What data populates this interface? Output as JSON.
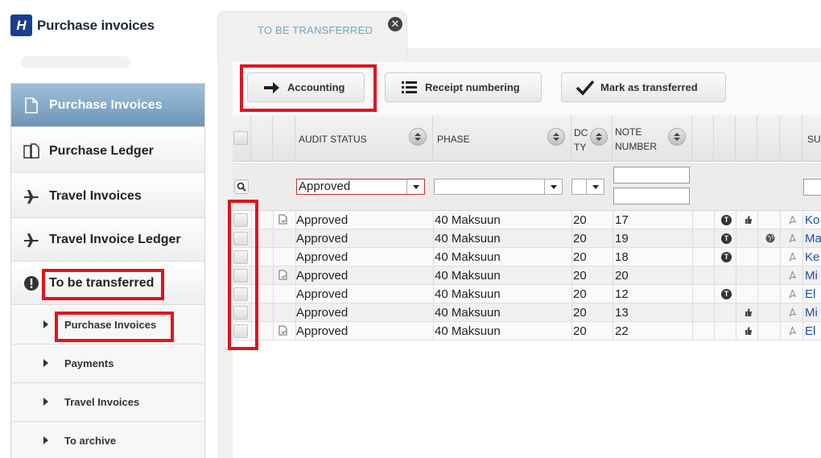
{
  "app": {
    "title": "Purchase invoices",
    "logo_letter": "H"
  },
  "sidebar": {
    "items": [
      {
        "label": "Purchase Invoices",
        "icon": "document-icon",
        "active": true
      },
      {
        "label": "Purchase Ledger",
        "icon": "documents-icon"
      },
      {
        "label": "Travel Invoices",
        "icon": "airplane-icon"
      },
      {
        "label": "Travel Invoice Ledger",
        "icon": "airplane-icon"
      },
      {
        "label": "To be transferred",
        "icon": "exclamation-icon"
      }
    ],
    "subitems": [
      {
        "label": "Purchase Invoices"
      },
      {
        "label": "Payments"
      },
      {
        "label": "Travel Invoices"
      },
      {
        "label": "To archive"
      }
    ]
  },
  "tab": {
    "label": "TO BE TRANSFERRED",
    "close_icon": "close-icon"
  },
  "toolbar": {
    "accounting": "Accounting",
    "receipt_numbering": "Receipt numbering",
    "mark_transferred": "Mark as transferred"
  },
  "grid": {
    "headers": {
      "audit_status": "AUDIT STATUS",
      "phase": "PHASE",
      "doc_type_1": "DC",
      "doc_type_2": "TY",
      "note_number_1": "NOTE",
      "note_number_2": "NUMBER",
      "supplier": "SU"
    },
    "filters": {
      "audit_status": "Approved",
      "phase": "",
      "doc_type": ""
    },
    "rows": [
      {
        "doc": true,
        "audit": "Approved",
        "phase": "40 Maksuun",
        "type": "20",
        "note": "17",
        "t": true,
        "thumb": true,
        "globe": false,
        "supplier": "Ko"
      },
      {
        "doc": false,
        "audit": "Approved",
        "phase": "40 Maksuun",
        "type": "20",
        "note": "19",
        "t": true,
        "thumb": false,
        "globe": true,
        "supplier": "Ma"
      },
      {
        "doc": false,
        "audit": "Approved",
        "phase": "40 Maksuun",
        "type": "20",
        "note": "18",
        "t": true,
        "thumb": false,
        "globe": false,
        "supplier": "Ke"
      },
      {
        "doc": true,
        "audit": "Approved",
        "phase": "40 Maksuun",
        "type": "20",
        "note": "20",
        "t": false,
        "thumb": false,
        "globe": false,
        "supplier": "Mi"
      },
      {
        "doc": false,
        "audit": "Approved",
        "phase": "40 Maksuun",
        "type": "20",
        "note": "12",
        "t": true,
        "thumb": false,
        "globe": false,
        "supplier": "El"
      },
      {
        "doc": false,
        "audit": "Approved",
        "phase": "40 Maksuun",
        "type": "20",
        "note": "13",
        "t": false,
        "thumb": true,
        "globe": false,
        "supplier": "Mi"
      },
      {
        "doc": true,
        "audit": "Approved",
        "phase": "40 Maksuun",
        "type": "20",
        "note": "22",
        "t": false,
        "thumb": true,
        "globe": false,
        "supplier": "El"
      }
    ]
  },
  "colors": {
    "highlight": "#e0141e",
    "active_nav": "#7fa4c4",
    "tab_text": "#6ea6c6",
    "supplier_link": "#1a4ea8"
  }
}
